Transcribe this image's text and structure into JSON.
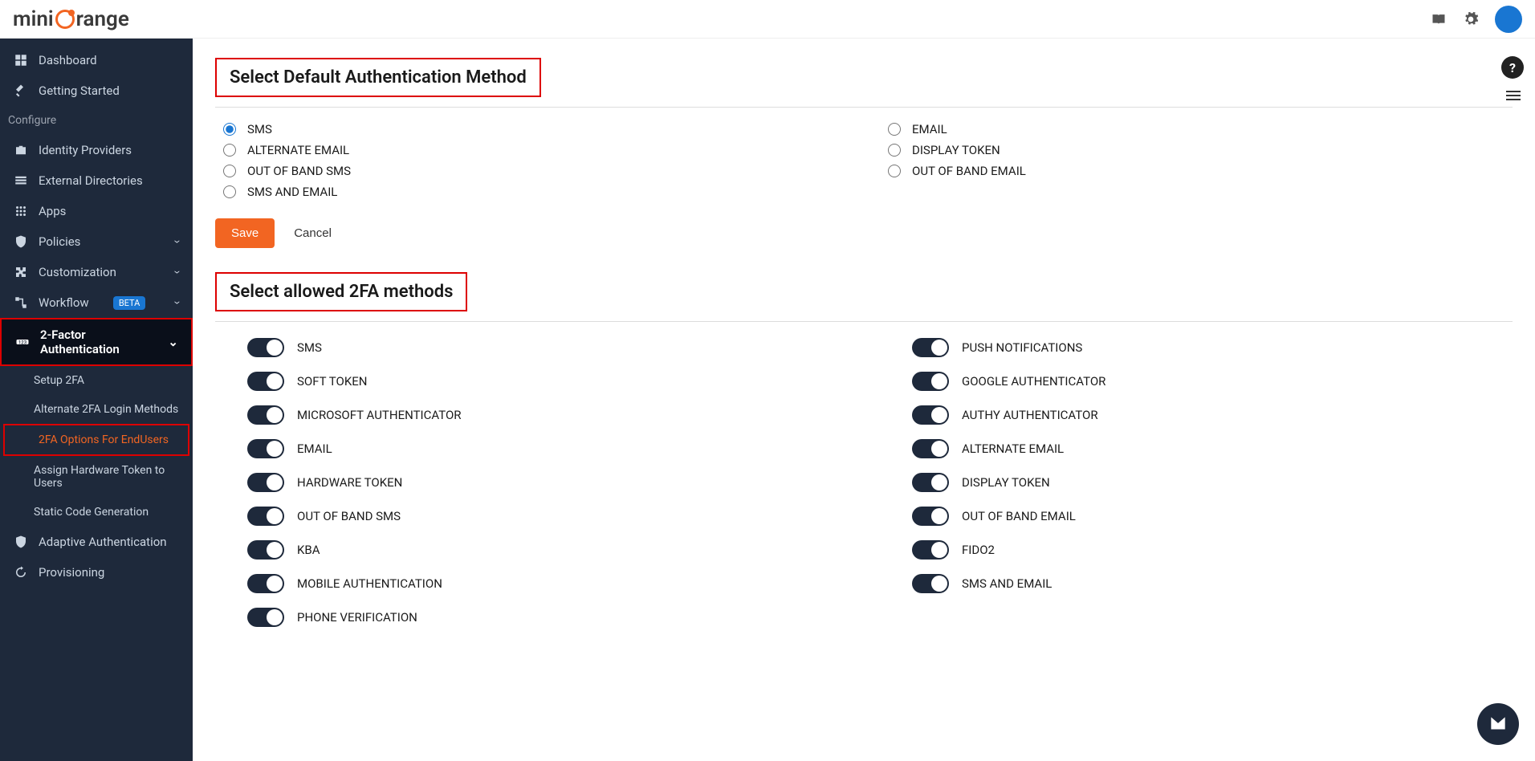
{
  "header": {
    "logo_prefix": "mini",
    "logo_suffix": "range"
  },
  "sidebar": {
    "dashboard": "Dashboard",
    "getting_started": "Getting Started",
    "configure_label": "Configure",
    "identity_providers": "Identity Providers",
    "external_directories": "External Directories",
    "apps": "Apps",
    "policies": "Policies",
    "customization": "Customization",
    "workflow": "Workflow",
    "workflow_badge": "BETA",
    "two_factor": "2-Factor Authentication",
    "sub_setup_2fa": "Setup 2FA",
    "sub_alternate": "Alternate 2FA Login Methods",
    "sub_endusers": "2FA Options For EndUsers",
    "sub_hardware": "Assign Hardware Token to Users",
    "sub_static": "Static Code Generation",
    "adaptive_auth": "Adaptive Authentication",
    "provisioning": "Provisioning"
  },
  "main": {
    "section1_title": "Select Default Authentication Method",
    "radios_left": [
      "SMS",
      "ALTERNATE EMAIL",
      "OUT OF BAND SMS",
      "SMS AND EMAIL"
    ],
    "radios_right": [
      "EMAIL",
      "DISPLAY TOKEN",
      "OUT OF BAND EMAIL"
    ],
    "save_btn": "Save",
    "cancel_btn": "Cancel",
    "section2_title": "Select allowed 2FA methods",
    "toggles_left": [
      "SMS",
      "SOFT TOKEN",
      "MICROSOFT AUTHENTICATOR",
      "EMAIL",
      "HARDWARE TOKEN",
      "OUT OF BAND SMS",
      "KBA",
      "MOBILE AUTHENTICATION",
      "PHONE VERIFICATION"
    ],
    "toggles_right": [
      "PUSH NOTIFICATIONS",
      "GOOGLE AUTHENTICATOR",
      "AUTHY AUTHENTICATOR",
      "ALTERNATE EMAIL",
      "DISPLAY TOKEN",
      "OUT OF BAND EMAIL",
      "FIDO2",
      "SMS AND EMAIL"
    ]
  }
}
